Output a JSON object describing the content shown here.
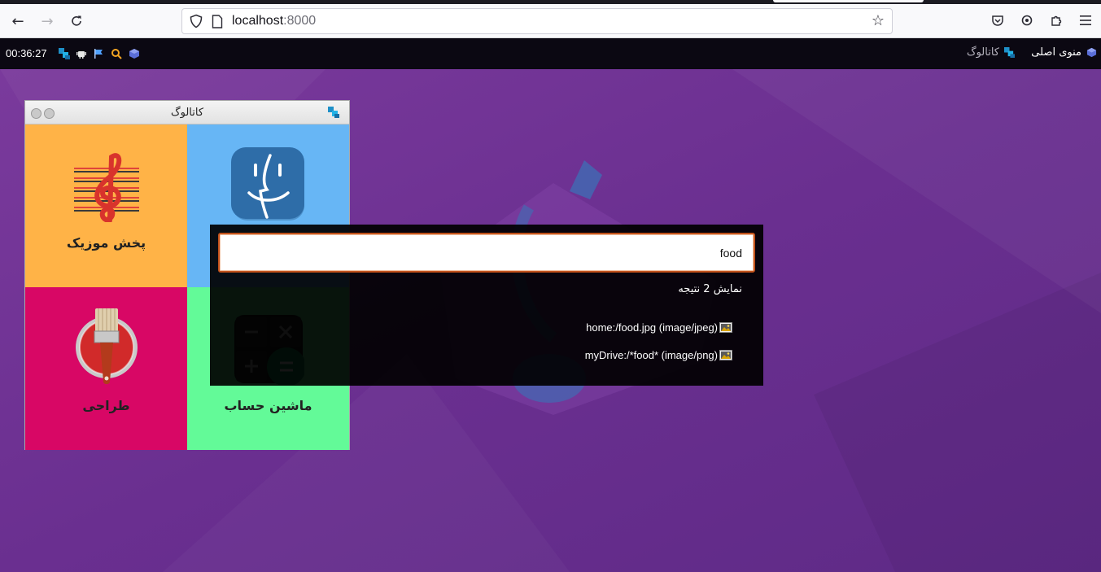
{
  "browser": {
    "url_host": "localhost",
    "url_port": ":8000",
    "icons": [
      "back-arrow",
      "forward-arrow",
      "reload",
      "shield",
      "page",
      "bookmark-star",
      "pocket",
      "account",
      "extensions",
      "hamburger-menu"
    ]
  },
  "topbar": {
    "clock": "00:36:27",
    "main_menu_label": "منوی اصلی",
    "catalog_label": "کاتالوگ"
  },
  "window": {
    "title": "کاتالوگ",
    "tiles": [
      {
        "label": "پخش موزیک",
        "color": "#ffb347",
        "icon": "music-clef"
      },
      {
        "label": "",
        "color": "#67b6f5",
        "icon": "finder"
      },
      {
        "label": "طراحی",
        "color": "#d80765",
        "icon": "paint-brush"
      },
      {
        "label": "ماشین حساب",
        "color": "#63fa98",
        "icon": "calculator"
      }
    ]
  },
  "search": {
    "query": "food",
    "count_text": "نمایش 2 نتیجه",
    "results": [
      {
        "text": "home:/food.jpg (image/jpeg)",
        "icon": "image-file"
      },
      {
        "text": "myDrive:/*food* (image/png)",
        "icon": "image-file"
      }
    ]
  },
  "colors": {
    "desktop": "#6a2f90",
    "topbar": "#0b0812",
    "search_border": "#c2521b"
  }
}
